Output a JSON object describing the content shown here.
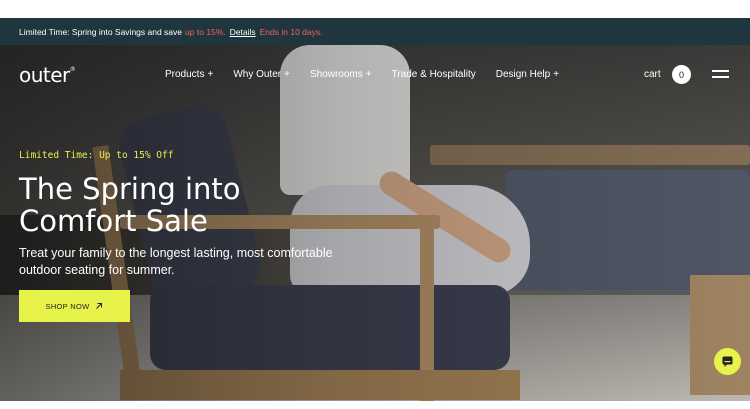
{
  "announcement": {
    "text": "Limited Time: Spring into Savings and save",
    "highlight": "up to 15%.",
    "details_link": "Details",
    "ends": "Ends in 10 days."
  },
  "header": {
    "logo": "outer",
    "logo_mark": "®",
    "nav": [
      {
        "label": "Products",
        "plus": "+"
      },
      {
        "label": "Why Outer",
        "plus": "+"
      },
      {
        "label": "Showrooms",
        "plus": "+"
      },
      {
        "label": "Trade & Hospitality",
        "plus": ""
      },
      {
        "label": "Design Help",
        "plus": "+"
      }
    ],
    "cart_label": "cart",
    "cart_count": "0",
    "menu_icon": "hamburger-menu-icon"
  },
  "hero": {
    "eyebrow": "Limited Time: Up to 15% Off",
    "headline_line1": "The Spring into",
    "headline_line2": "Comfort Sale",
    "subcopy_line1": "Treat your family to the longest lasting, most comfortable",
    "subcopy_line2": "outdoor seating for summer.",
    "cta_label": "SHOP NOW",
    "cta_icon": "arrow-up-right-icon"
  },
  "chat": {
    "icon": "chat-bubble-icon"
  },
  "colors": {
    "announcement_bg": "#20363f",
    "announcement_accent": "#f0615a",
    "brand_accent": "#e7f24a"
  }
}
